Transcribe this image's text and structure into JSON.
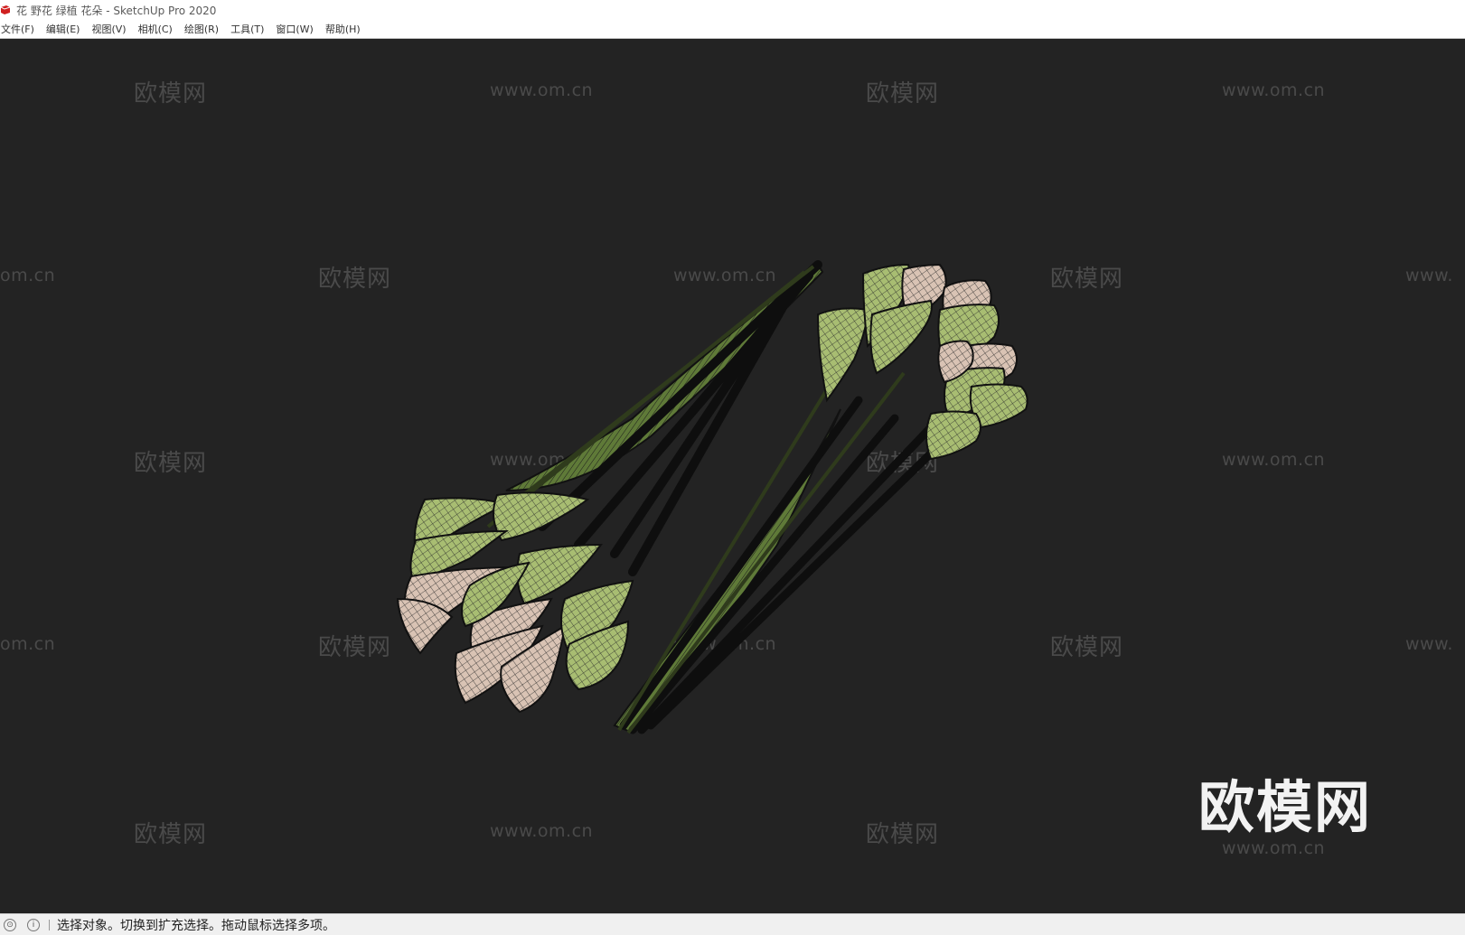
{
  "window": {
    "title": "花 野花 绿植 花朵 - SketchUp Pro 2020"
  },
  "menu": {
    "items": [
      {
        "label": "文件(F)"
      },
      {
        "label": "编辑(E)"
      },
      {
        "label": "视图(V)"
      },
      {
        "label": "相机(C)"
      },
      {
        "label": "绘图(R)"
      },
      {
        "label": "工具(T)"
      },
      {
        "label": "窗口(W)"
      },
      {
        "label": "帮助(H)"
      }
    ]
  },
  "viewport": {
    "background": "#232323",
    "watermark_cn": "欧模网",
    "watermark_url": "www.om.cn",
    "watermark_url_left_fragment": "om.cn",
    "watermark_url_right_fragment": "www.",
    "logo_text": "欧模网",
    "logo_url": "www.om.cn"
  },
  "status": {
    "icon_1": "geo-location-icon",
    "icon_2": "info-icon",
    "text": "选择对象。切换到扩充选择。拖动鼠标选择多项。"
  },
  "colors": {
    "leaf_green": "#7f9a4e",
    "flower_green": "#a8bd72",
    "flower_pink": "#d9c3b4",
    "mesh_line": "#1c1c1c"
  }
}
